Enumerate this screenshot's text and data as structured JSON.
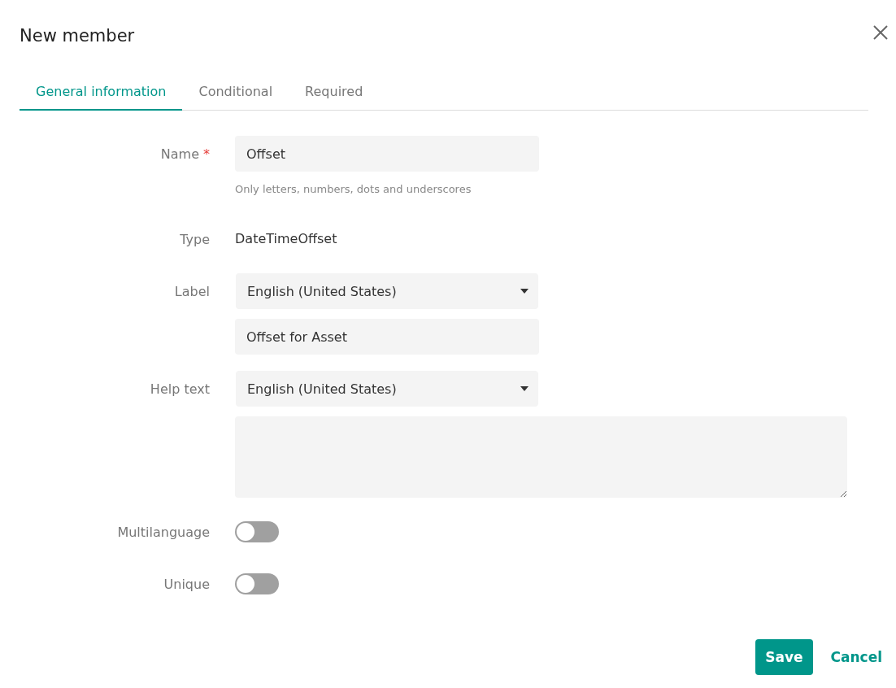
{
  "dialog": {
    "title": "New member"
  },
  "tabs": [
    {
      "label": "General information",
      "selected": true
    },
    {
      "label": "Conditional",
      "selected": false
    },
    {
      "label": "Required",
      "selected": false
    }
  ],
  "fields": [
    {
      "kind": "text",
      "label": "Name",
      "required_mark": "*",
      "value": "Offset",
      "hint": "Only letters, numbers, dots and underscores"
    },
    {
      "kind": "static",
      "label": "Type",
      "value": "DateTimeOffset"
    },
    {
      "kind": "localized",
      "label": "Label",
      "language": "English (United States)",
      "value": "Offset for Asset"
    },
    {
      "kind": "localized_multiline",
      "label": "Help text",
      "language": "English (United States)"
    },
    {
      "kind": "toggle",
      "label": "Multilanguage",
      "on": false
    },
    {
      "kind": "toggle",
      "label": "Unique",
      "on": false
    }
  ],
  "buttons": [
    {
      "label": "Save",
      "kind": "primary"
    },
    {
      "label": "Cancel",
      "kind": "link"
    }
  ]
}
